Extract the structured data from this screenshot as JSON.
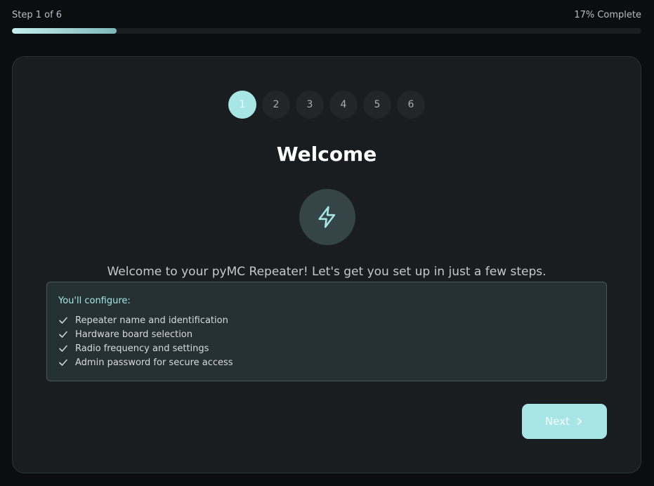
{
  "header": {
    "step_text": "Step 1 of 6",
    "percent_text": "17% Complete",
    "progress_fraction": 0.166
  },
  "stepper": {
    "steps": [
      "1",
      "2",
      "3",
      "4",
      "5",
      "6"
    ],
    "active_index": 0
  },
  "main": {
    "title": "Welcome",
    "icon": "lightning-bolt-icon",
    "subtitle": "Welcome to your pyMC Repeater! Let's get you set up in just a few steps."
  },
  "configure": {
    "heading": "You'll configure:",
    "items": [
      "Repeater name and identification",
      "Hardware board selection",
      "Radio frequency and settings",
      "Admin password for secure access"
    ]
  },
  "footer": {
    "next_label": "Next"
  },
  "colors": {
    "accent": "#a8e6e6",
    "background": "#0c0d0f",
    "card": "#1a1d1f"
  }
}
